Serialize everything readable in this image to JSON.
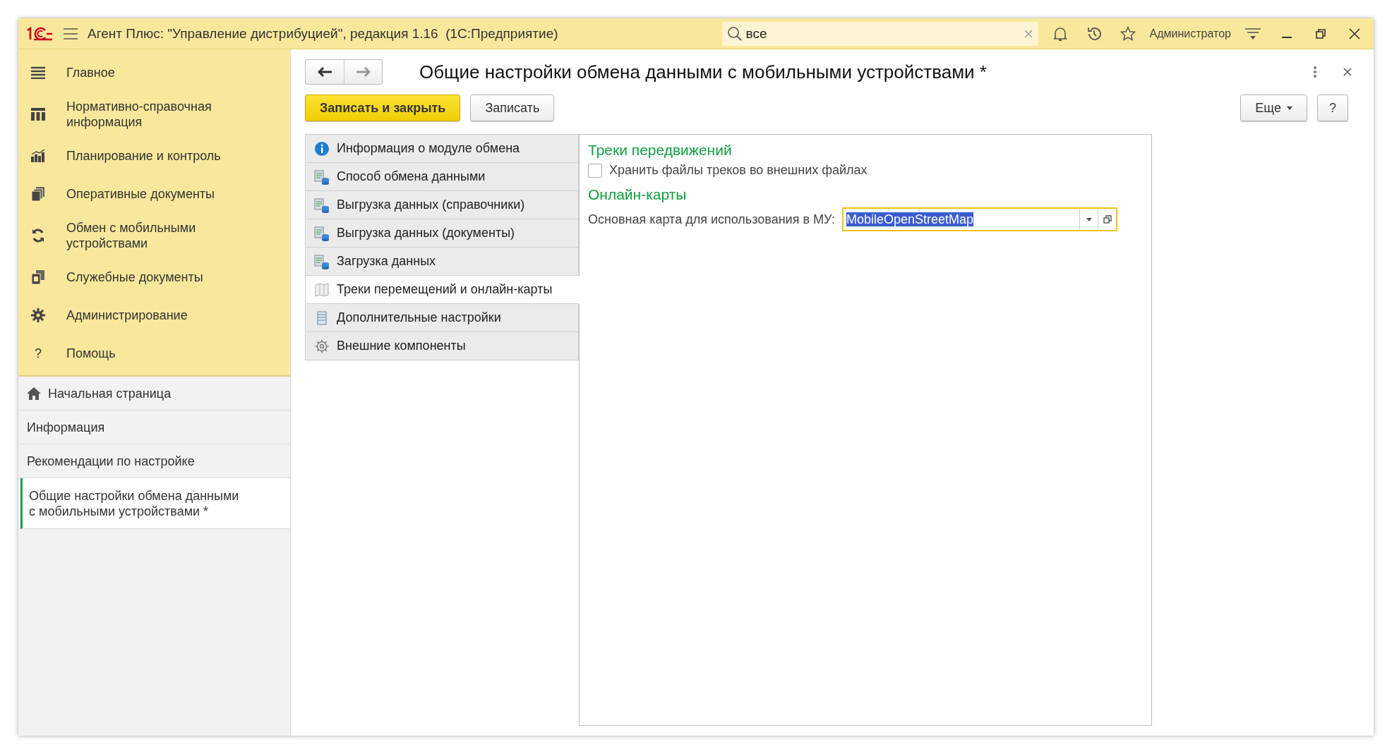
{
  "title_bar": {
    "title": "Агент Плюс: \"Управление дистрибуцией\", редакция 1.16  (1С:Предприятие)",
    "search": {
      "value": "все"
    },
    "user": "Администратор"
  },
  "sections": [
    {
      "label": "Главное"
    },
    {
      "label": "Нормативно-справочная информация"
    },
    {
      "label": "Планирование и контроль"
    },
    {
      "label": "Оперативные документы"
    },
    {
      "label": "Обмен с мобильными устройствами"
    },
    {
      "label": "Служебные документы"
    },
    {
      "label": "Администрирование"
    },
    {
      "label": "Помощь",
      "icon_text": "?"
    }
  ],
  "open_windows": [
    {
      "label": "Начальная страница",
      "kind": "home",
      "selected": false
    },
    {
      "label": "Информация",
      "kind": "plain",
      "selected": false
    },
    {
      "label": "Рекомендации по настройке",
      "kind": "plain",
      "selected": false
    },
    {
      "label": "Общие настройки обмена данными с мобильными устройствами *",
      "kind": "plain",
      "selected": true
    }
  ],
  "form": {
    "title": "Общие настройки обмена данными с мобильными устройствами *",
    "buttons": [
      {
        "label": "Записать и закрыть",
        "kind": "primary"
      },
      {
        "label": "Записать",
        "kind": "normal"
      }
    ],
    "more_button": "Еще",
    "help_button": "?",
    "tabs": [
      {
        "label": "Информация о модуле обмена",
        "selected": false
      },
      {
        "label": "Способ обмена данными",
        "selected": false
      },
      {
        "label": "Выгрузка данных (справочники)",
        "selected": false
      },
      {
        "label": "Выгрузка данных (документы)",
        "selected": false
      },
      {
        "label": "Загрузка данных",
        "selected": false
      },
      {
        "label": "Треки перемещений и онлайн-карты",
        "selected": true
      },
      {
        "label": "Дополнительные настройки",
        "selected": false
      },
      {
        "label": "Внешние компоненты",
        "selected": false
      }
    ],
    "groups": [
      {
        "heading": "Треки передвижений",
        "kind": "checkbox",
        "label": "Хранить файлы треков во внешних файлах",
        "checked": false
      },
      {
        "heading": "Онлайн-карты",
        "kind": "select",
        "label": "Основная карта для использования в МУ:",
        "value": "MobileOpenStreetMap",
        "selected_text": true
      }
    ]
  }
}
